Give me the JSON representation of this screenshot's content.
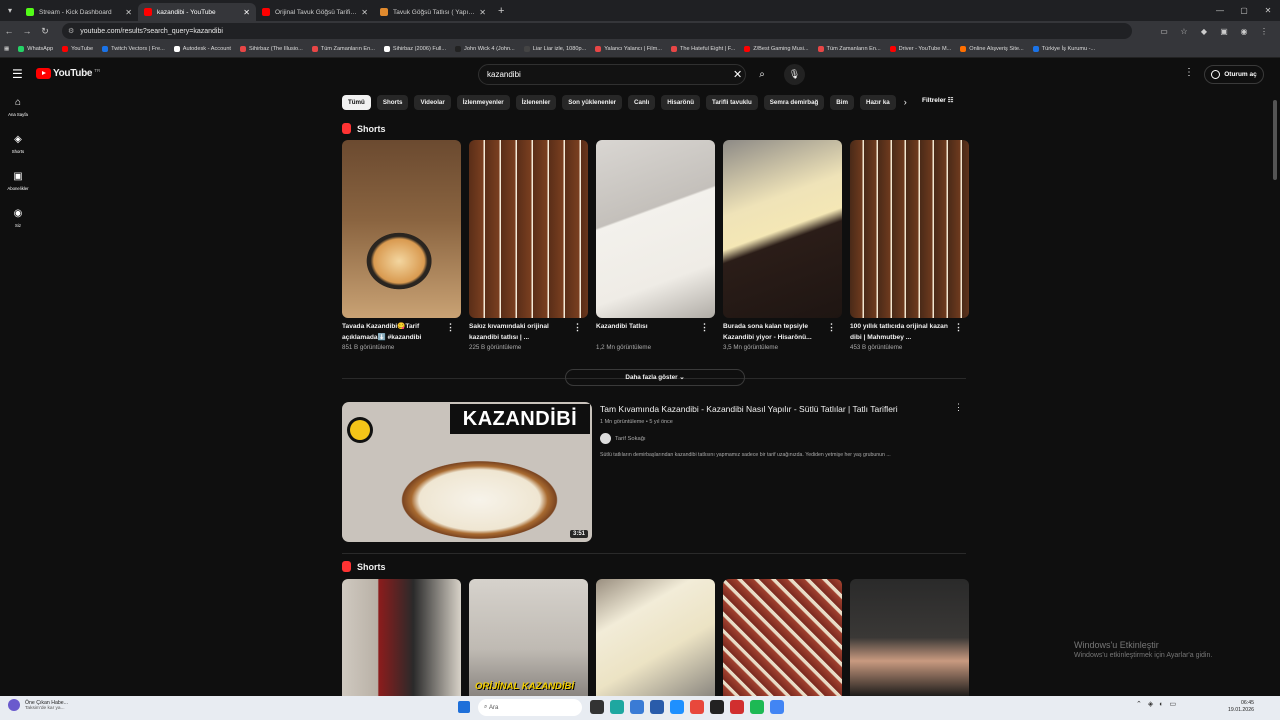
{
  "browser": {
    "tabs": [
      {
        "title": "Stream - Kick Dashboard",
        "color": "#53fc18"
      },
      {
        "title": "kazandibi - YouTube",
        "color": "#ff0000"
      },
      {
        "title": "Orijinal Tavuk Göğsü Tarifi 💖 ...",
        "color": "#ff0000"
      },
      {
        "title": "Tavuk Göğsü Tatlısı ( Yapımı Aşa...",
        "color": "#e08a2e"
      }
    ],
    "url": "youtube.com/results?search_query=kazandibi",
    "bookmarks": [
      {
        "label": "WhatsApp",
        "color": "#25d366"
      },
      {
        "label": "YouTube",
        "color": "#ff0000"
      },
      {
        "label": "Twitch Vectors | Fre...",
        "color": "#1a73e8"
      },
      {
        "label": "Autodesk - Account",
        "color": "#ffffff"
      },
      {
        "label": "Sihirbaz (The Illusio...",
        "color": "#e84646"
      },
      {
        "label": "Tüm Zamanların En...",
        "color": "#e84646"
      },
      {
        "label": "Sihirbaz (2006) Full...",
        "color": "#ffffff"
      },
      {
        "label": "John Wick 4 (John...",
        "color": "#222222"
      },
      {
        "label": "Liar Liar izle, 1080p...",
        "color": "#444444"
      },
      {
        "label": "Yalancı Yalancı | Film...",
        "color": "#e84646"
      },
      {
        "label": "The Hateful Eight | F...",
        "color": "#e84646"
      },
      {
        "label": "Z/Best Gaming Musi...",
        "color": "#ff0000"
      },
      {
        "label": "Tüm Zamanların En...",
        "color": "#e84646"
      },
      {
        "label": "Driver - YouTube M...",
        "color": "#ff0000"
      },
      {
        "label": "Online Alışveriş Site...",
        "color": "#ff6f00"
      },
      {
        "label": "Türkiye İş Kurumu -...",
        "color": "#1a73e8"
      }
    ]
  },
  "yt": {
    "logo_text": "YouTube",
    "country": "TR",
    "search_value": "kazandibi",
    "sign_in": "Oturum aç",
    "sidebar": [
      {
        "label": "Ana Sayfa",
        "icon": "⌂"
      },
      {
        "label": "Shorts",
        "icon": "◈"
      },
      {
        "label": "Abonelikler",
        "icon": "▣"
      },
      {
        "label": "Siz",
        "icon": "◉"
      }
    ],
    "chips": [
      "Tümü",
      "Shorts",
      "Videolar",
      "İzlenmeyenler",
      "İzlenenler",
      "Son yüklenenler",
      "Canlı",
      "Hisarönü",
      "Tarifli tavuklu",
      "Semra demirbağ",
      "Bim",
      "Hazır ka"
    ],
    "filters": "Filtreler",
    "shorts_title": "Shorts",
    "shorts": [
      {
        "title": "Tavada Kazandibi😋Tarif açıklamada⬇️ #kazandibi",
        "views": "851 B görüntüleme"
      },
      {
        "title": "Sakız kıvamındaki orijinal kazandibi tatlısı | ...",
        "views": "225 B görüntüleme"
      },
      {
        "title": "Kazandibi Tatlısı",
        "views": "1,2 Mn görüntüleme"
      },
      {
        "title": "Burada sona kalan tepsiyle Kazandibi yiyor - Hisarönü...",
        "views": "3,5 Mn görüntüleme"
      },
      {
        "title": "100 yıllık tatlıcıda orijinal kazan dibi | Mahmutbey ...",
        "views": "453 B görüntüleme"
      }
    ],
    "show_more": "Daha fazla göster",
    "video": {
      "title": "Tam Kıvamında Kazandibi - Kazandibi Nasıl Yapılır - Sütlü Tatlılar | Tatlı Tarifleri",
      "views": "1 Mn görüntüleme",
      "age": "5 yıl önce",
      "channel": "Tarif Sokağı",
      "description": "Sütlü tatlıların demirbaşlarından kazandibi tatlısını yapmamız sadece bir tarif uzağınızda. Yediden yetmişe her yaş grubunun ...",
      "duration": "3:51",
      "thumb_text": "KAZANDİBİ"
    },
    "shorts2_title": "Shorts",
    "shorts2_thumb_text": "ORİJİNAL KAZANDİBİ"
  },
  "watermark": {
    "line1": "Windows'u Etkinleştir",
    "line2": "Windows'u etkinleştirmek için Ayarlar'a gidin."
  },
  "taskbar": {
    "news_title": "Öne Çıkan Habe...",
    "news_sub": "Taksim'de kar ya...",
    "search_placeholder": "Ara",
    "time": "06:45",
    "date": "19.01.2026"
  }
}
